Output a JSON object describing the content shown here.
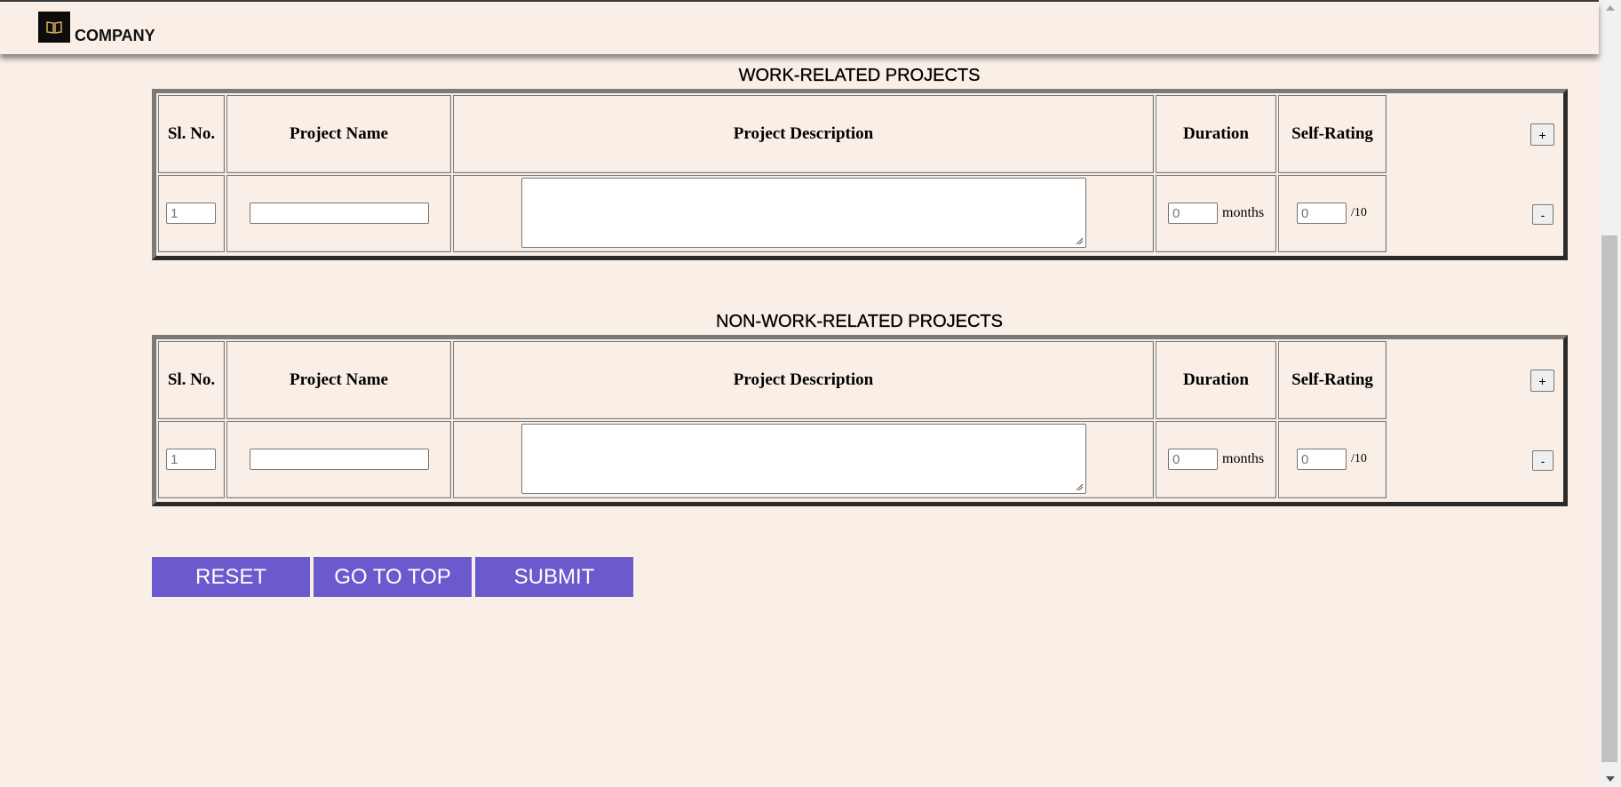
{
  "header": {
    "brand": "COMPANY",
    "logo_icon": "book-logo-icon"
  },
  "sections": [
    {
      "title": "WORK-RELATED PROJECTS",
      "columns": [
        "Sl. No.",
        "Project Name",
        "Project Description",
        "Duration",
        "Self-Rating"
      ],
      "add_label": "+",
      "remove_label": "-",
      "row": {
        "sl_no_placeholder": "1",
        "project_name_value": "",
        "description_value": "",
        "duration_placeholder": "0",
        "duration_unit": "months",
        "rating_placeholder": "0",
        "rating_unit": "/10"
      }
    },
    {
      "title": "NON-WORK-RELATED PROJECTS",
      "columns": [
        "Sl. No.",
        "Project Name",
        "Project Description",
        "Duration",
        "Self-Rating"
      ],
      "add_label": "+",
      "remove_label": "-",
      "row": {
        "sl_no_placeholder": "1",
        "project_name_value": "",
        "description_value": "",
        "duration_placeholder": "0",
        "duration_unit": "months",
        "rating_placeholder": "0",
        "rating_unit": "/10"
      }
    }
  ],
  "actions": {
    "reset": "RESET",
    "go_to_top": "GO TO TOP",
    "submit": "SUBMIT"
  },
  "colors": {
    "background": "#f9efe6",
    "button": "#6a5acd"
  }
}
